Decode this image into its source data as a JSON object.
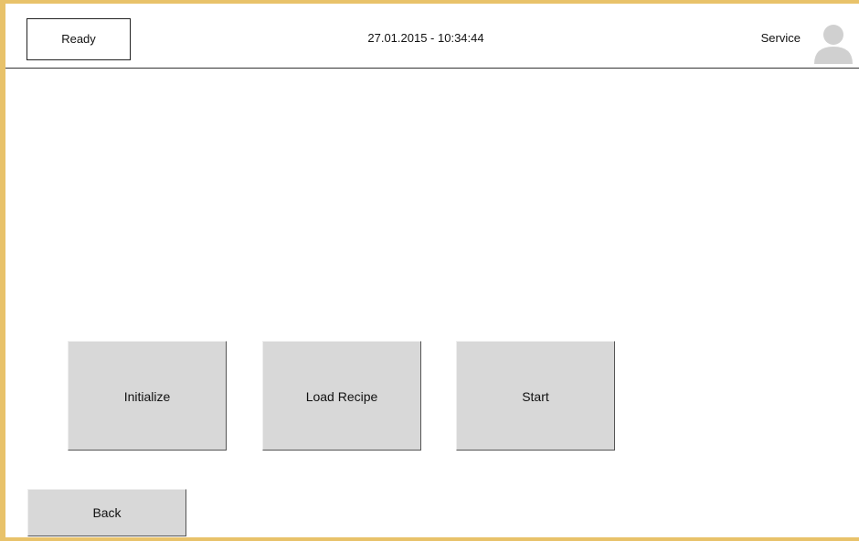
{
  "header": {
    "status": "Ready",
    "datetime": "27.01.2015 - 10:34:44",
    "user": "Service",
    "user_icon": "user-avatar-icon"
  },
  "actions": {
    "initialize": "Initialize",
    "load_recipe": "Load Recipe",
    "start": "Start"
  },
  "footer": {
    "back": "Back"
  },
  "colors": {
    "frame": "#e8c26a",
    "button_bg": "#d8d8d8",
    "avatar": "#d0d0d0"
  }
}
